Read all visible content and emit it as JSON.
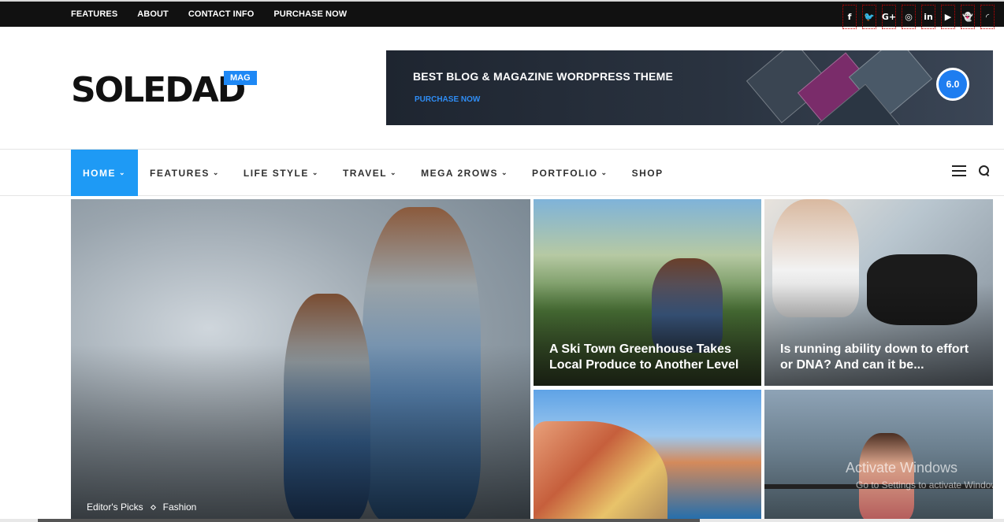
{
  "topbar": {
    "links": [
      "FEATURES",
      "ABOUT",
      "CONTACT INFO",
      "PURCHASE NOW"
    ],
    "social": [
      {
        "name": "facebook-icon",
        "glyph": "f"
      },
      {
        "name": "twitter-icon",
        "glyph": "🐦"
      },
      {
        "name": "google-plus-icon",
        "glyph": "G+"
      },
      {
        "name": "instagram-icon",
        "glyph": "◎"
      },
      {
        "name": "linkedin-icon",
        "glyph": "in"
      },
      {
        "name": "youtube-icon",
        "glyph": "▶"
      },
      {
        "name": "snapchat-icon",
        "glyph": "👻"
      },
      {
        "name": "rss-icon",
        "glyph": "◜"
      }
    ]
  },
  "logo": {
    "text": "SOLEDAD",
    "badge": "MAG"
  },
  "banner": {
    "title": "BEST BLOG & MAGAZINE WORDPRESS THEME",
    "cta": "PURCHASE NOW",
    "version": "6.0"
  },
  "nav": {
    "items": [
      {
        "label": "HOME",
        "chevron": true,
        "active": true
      },
      {
        "label": "FEATURES",
        "chevron": true
      },
      {
        "label": "LIFE STYLE",
        "chevron": true
      },
      {
        "label": "TRAVEL",
        "chevron": true
      },
      {
        "label": "MEGA 2ROWS",
        "chevron": true
      },
      {
        "label": "PORTFOLIO",
        "chevron": true
      },
      {
        "label": "SHOP",
        "chevron": false
      }
    ]
  },
  "featured": {
    "main": {
      "categories": [
        "Editor's Picks",
        "Fashion"
      ]
    },
    "tiles": [
      {
        "title": "A Ski Town Greenhouse Takes Local Produce to Another Level"
      },
      {
        "title": "Is running ability down to effort or DNA? And can it be..."
      }
    ]
  },
  "watermark": {
    "title": "Activate Windows",
    "subtitle": "Go to Settings to activate Windows."
  },
  "colors": {
    "accent": "#1e9af5",
    "topbar": "#111111"
  }
}
